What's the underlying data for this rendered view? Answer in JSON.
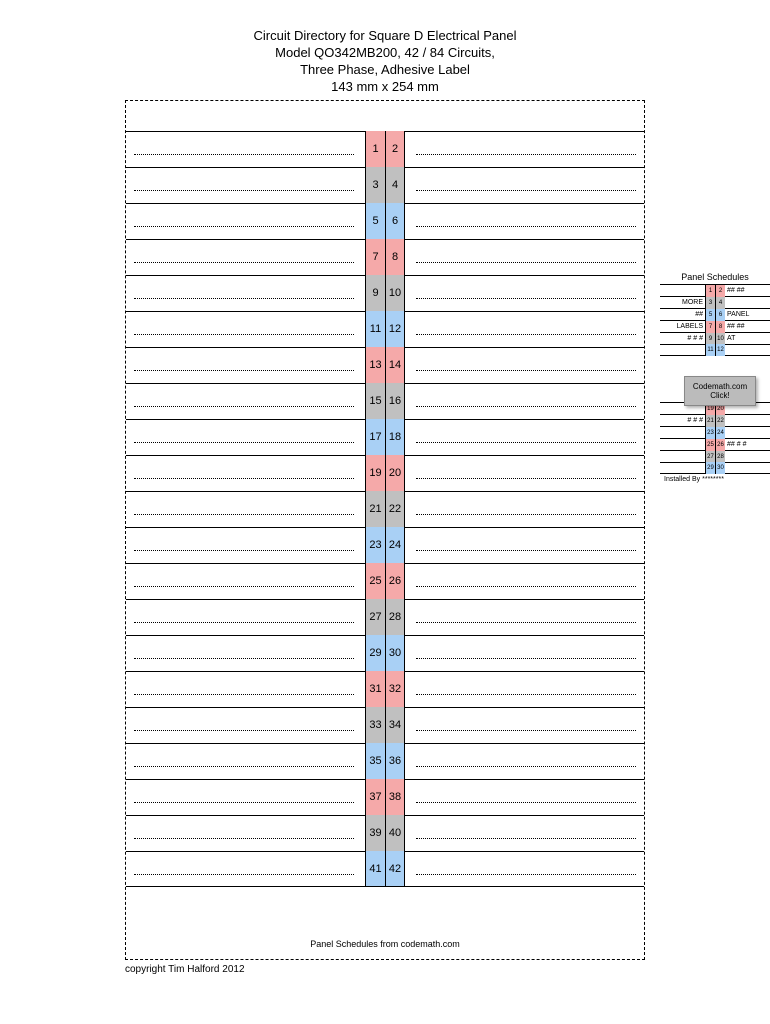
{
  "header": {
    "line1": "Circuit Directory for Square D Electrical Panel",
    "line2": "Model QO342MB200, 42 / 84 Circuits,",
    "line3": "Three Phase, Adhesive Label",
    "line4": "143 mm x 254 mm"
  },
  "colors": [
    "c-pink",
    "c-gray",
    "c-blue"
  ],
  "circuits": [
    {
      "l": "1",
      "r": "2",
      "c": "c-pink"
    },
    {
      "l": "3",
      "r": "4",
      "c": "c-gray"
    },
    {
      "l": "5",
      "r": "6",
      "c": "c-blue"
    },
    {
      "l": "7",
      "r": "8",
      "c": "c-pink"
    },
    {
      "l": "9",
      "r": "10",
      "c": "c-gray"
    },
    {
      "l": "11",
      "r": "12",
      "c": "c-blue"
    },
    {
      "l": "13",
      "r": "14",
      "c": "c-pink"
    },
    {
      "l": "15",
      "r": "16",
      "c": "c-gray"
    },
    {
      "l": "17",
      "r": "18",
      "c": "c-blue"
    },
    {
      "l": "19",
      "r": "20",
      "c": "c-pink"
    },
    {
      "l": "21",
      "r": "22",
      "c": "c-gray"
    },
    {
      "l": "23",
      "r": "24",
      "c": "c-blue"
    },
    {
      "l": "25",
      "r": "26",
      "c": "c-pink"
    },
    {
      "l": "27",
      "r": "28",
      "c": "c-gray"
    },
    {
      "l": "29",
      "r": "30",
      "c": "c-blue"
    },
    {
      "l": "31",
      "r": "32",
      "c": "c-pink"
    },
    {
      "l": "33",
      "r": "34",
      "c": "c-gray"
    },
    {
      "l": "35",
      "r": "36",
      "c": "c-blue"
    },
    {
      "l": "37",
      "r": "38",
      "c": "c-pink"
    },
    {
      "l": "39",
      "r": "40",
      "c": "c-gray"
    },
    {
      "l": "41",
      "r": "42",
      "c": "c-blue"
    }
  ],
  "footer_inside": "Panel Schedules from codemath.com",
  "copyright": "copyright Tim Halford 2012",
  "thumb": {
    "title": "Panel Schedules",
    "top_rows": [
      {
        "lt": "",
        "l": "1",
        "r": "2",
        "rt": "## ##",
        "c": "c-pink"
      },
      {
        "lt": "MORE",
        "l": "3",
        "r": "4",
        "rt": "",
        "c": "c-gray"
      },
      {
        "lt": "##",
        "l": "5",
        "r": "6",
        "rt": "PANEL",
        "c": "c-blue"
      },
      {
        "lt": "LABELS",
        "l": "7",
        "r": "8",
        "rt": "## ##",
        "c": "c-pink"
      },
      {
        "lt": "# # #",
        "l": "9",
        "r": "10",
        "rt": "AT",
        "c": "c-gray"
      },
      {
        "lt": "",
        "l": "11",
        "r": "12",
        "rt": "",
        "c": "c-blue"
      }
    ],
    "button_line1": "Codemath.com",
    "button_line2": "Click!",
    "bottom_rows": [
      {
        "lt": "",
        "l": "19",
        "r": "20",
        "rt": "",
        "c": "c-pink"
      },
      {
        "lt": "# # #",
        "l": "21",
        "r": "22",
        "rt": "",
        "c": "c-gray"
      },
      {
        "lt": "",
        "l": "23",
        "r": "24",
        "rt": "",
        "c": "c-blue"
      },
      {
        "lt": "",
        "l": "25",
        "r": "26",
        "rt": "## # #",
        "c": "c-pink"
      },
      {
        "lt": "",
        "l": "27",
        "r": "28",
        "rt": "",
        "c": "c-gray"
      },
      {
        "lt": "",
        "l": "29",
        "r": "30",
        "rt": "",
        "c": "c-blue"
      }
    ],
    "installed_by": "Installed By ********"
  }
}
